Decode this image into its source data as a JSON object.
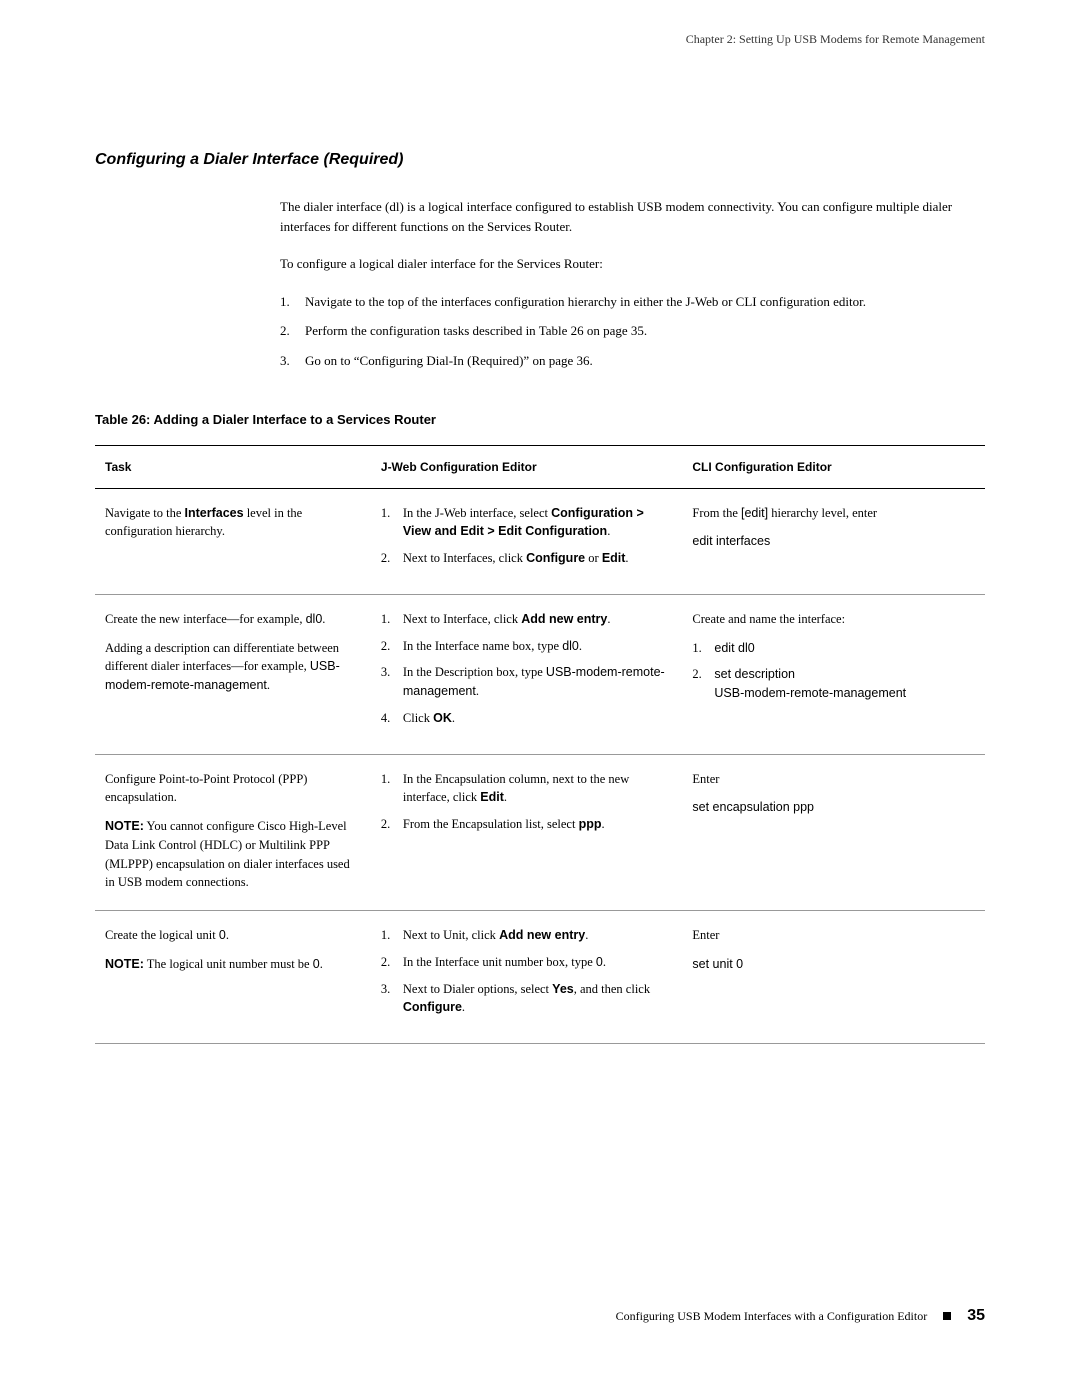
{
  "header": {
    "chapter": "Chapter 2: Setting Up USB Modems for Remote Management"
  },
  "section": {
    "title": "Configuring a Dialer Interface (Required)",
    "intro": "The dialer interface (dl) is a logical interface configured to establish USB modem connectivity. You can configure multiple dialer interfaces for different functions on the Services Router.",
    "lead": "To configure a logical dialer interface for the Services Router:",
    "steps": [
      "Navigate to the top of the interfaces configuration hierarchy in either the J-Web or CLI configuration editor.",
      "Perform the configuration tasks described in Table 26 on page 35.",
      "Go on to “Configuring Dial-In (Required)” on page 36."
    ]
  },
  "table": {
    "caption": "Table 26: Adding a Dialer Interface to a Services Router",
    "headers": {
      "task": "Task",
      "jweb": "J-Web Configuration Editor",
      "cli": "CLI Configuration Editor"
    }
  },
  "rows": {
    "r1": {
      "task_a": "Navigate to the ",
      "task_b": "Interfaces",
      "task_c": "  level in the configuration hierarchy.",
      "j1a": "In the J-Web interface, select ",
      "j1b": "Configuration > View and Edit > Edit Configuration",
      "j1c": ".",
      "j2a": "Next to Interfaces, click ",
      "j2b": "Configure",
      "j2c": " or ",
      "j2d": "Edit",
      "j2e": ".",
      "cli_a": "From the ",
      "cli_b": "[edit]",
      "cli_c": " hierarchy level, enter",
      "cli_cmd": "edit interfaces"
    },
    "r2": {
      "task_p1a": "Create the new interface—for example, ",
      "task_p1b": "dl0",
      "task_p1c": ".",
      "task_p2a": "Adding a description can differentiate between different dialer interfaces—for example, ",
      "task_p2b": "USB-modem-remote-management",
      "task_p2c": ".",
      "j1a": "Next to Interface, click ",
      "j1b": "Add new entry",
      "j1c": ".",
      "j2a": "In the Interface name box, type ",
      "j2b": "dl0",
      "j2c": ".",
      "j3a": "In the Description box, type ",
      "j3b": "USB-modem-remote-management",
      "j3c": ".",
      "j4a": "Click ",
      "j4b": "OK",
      "j4c": ".",
      "cli_lead": "Create and name the interface:",
      "cli_1a": "edit dl0",
      "cli_2a": "set description",
      "cli_2b": "USB-modem-remote-management"
    },
    "r3": {
      "task_p1": "Configure Point-to-Point Protocol (PPP) encapsulation.",
      "task_note_label": "NOTE:",
      "task_note": "  You cannot configure Cisco High-Level Data Link Control (HDLC) or Multilink PPP (MLPPP) encapsulation on dialer interfaces used in USB modem connections.",
      "j1a": "In the Encapsulation column, next to the new interface, click ",
      "j1b": "Edit",
      "j1c": ".",
      "j2a": "From the Encapsulation list, select ",
      "j2b": "ppp",
      "j2c": ".",
      "cli_lead": "Enter",
      "cli_cmd": "set encapsulation ppp"
    },
    "r4": {
      "task_p1a": "Create the logical unit ",
      "task_p1b": "0",
      "task_p1c": ".",
      "task_note_label": "NOTE:",
      "task_note_a": "  The logical unit number must be ",
      "task_note_b": "0",
      "task_note_c": ".",
      "j1a": "Next to Unit, click ",
      "j1b": "Add new entry",
      "j1c": ".",
      "j2a": "In the Interface unit number box, type ",
      "j2b": "0",
      "j2c": ".",
      "j3a": "Next to Dialer options, select ",
      "j3b": "Yes",
      "j3c": ", and then click ",
      "j3d": "Configure",
      "j3e": ".",
      "cli_lead": "Enter",
      "cli_cmd": "set unit 0"
    }
  },
  "footer": {
    "text": "Configuring USB Modem Interfaces with a Configuration Editor",
    "page": "35"
  }
}
